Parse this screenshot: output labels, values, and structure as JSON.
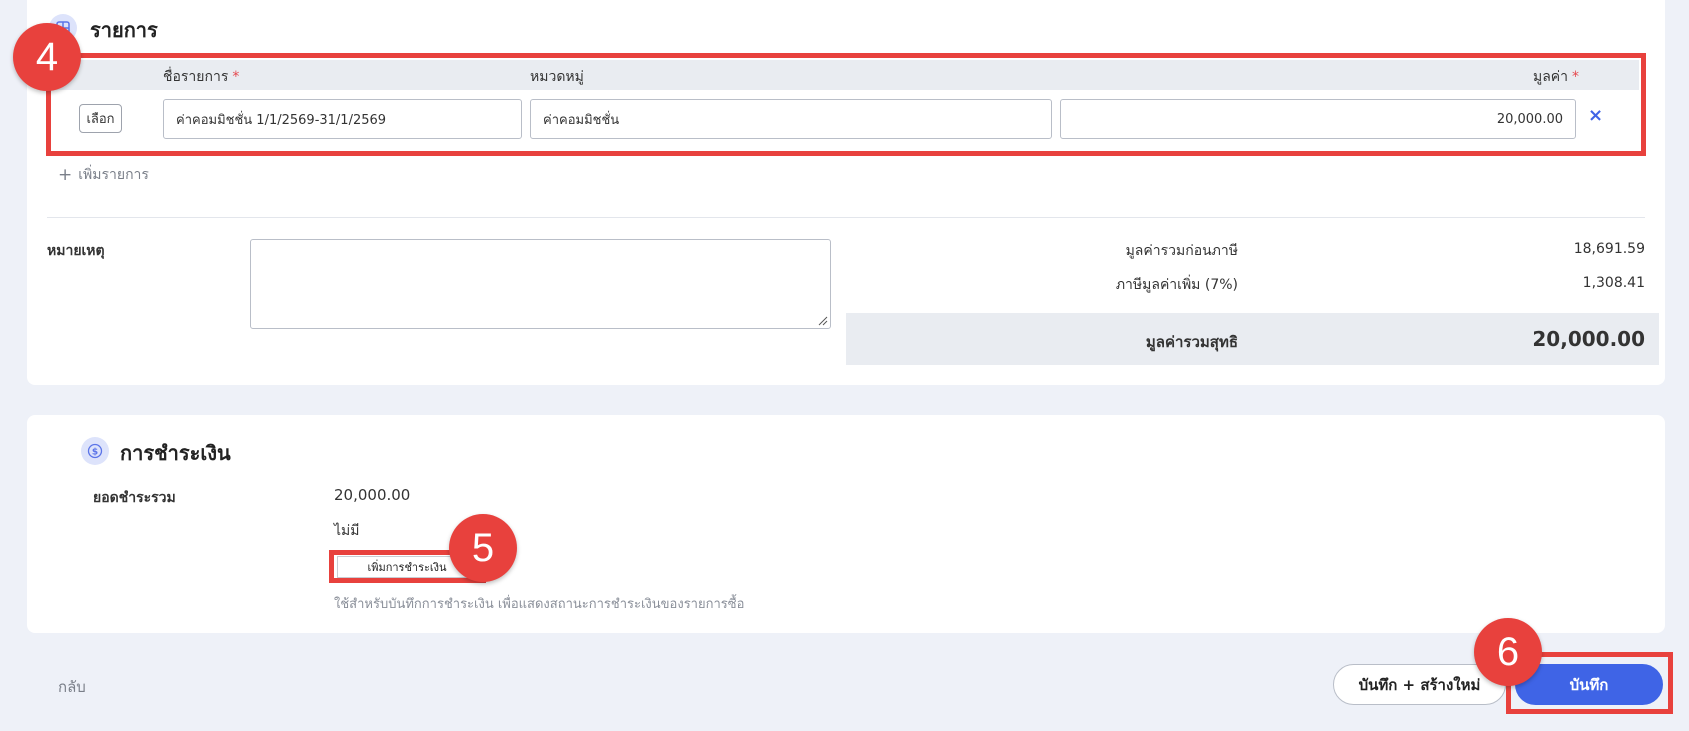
{
  "items_section": {
    "title": "รายการ",
    "headers": {
      "name": "ชื่อรายการ",
      "category": "หมวดหมู่",
      "value": "มูลค่า",
      "required_mark": "*"
    },
    "row": {
      "choose_label": "เลือก",
      "name": "ค่าคอมมิชชั่น 1/1/2569-31/1/2569",
      "category": "ค่าคอมมิชชั่น",
      "value": "20,000.00",
      "remove_icon": "×"
    },
    "add_item": "เพิ่มรายการ",
    "add_icon": "+"
  },
  "notes": {
    "label": "หมายเหตุ",
    "value": ""
  },
  "summary": {
    "subtotal_label": "มูลค่ารวมก่อนภาษี",
    "subtotal": "18,691.59",
    "vat_label": "ภาษีมูลค่าเพิ่ม (7%)",
    "vat": "1,308.41",
    "total_label": "มูลค่ารวมสุทธิ",
    "total": "20,000.00"
  },
  "payment": {
    "title": "การชำระเงิน",
    "total_label": "ยอดชำระรวม",
    "total": "20,000.00",
    "none": "ไม่มี",
    "add_button": "เพิ่มการชำระเงิน",
    "hint": "ใช้สำหรับบันทึกการชำระเงิน เพื่อแสดงสถานะการชำระเงินของรายการซื้อ"
  },
  "footer": {
    "back": "กลับ",
    "save_new": "บันทึก + สร้างใหม่",
    "save": "บันทึก"
  },
  "annotations": {
    "step4": "4",
    "step5": "5",
    "step6": "6"
  },
  "colors": {
    "accent": "#3f64e6",
    "highlight": "#e8413d",
    "background": "#eef1f8"
  }
}
